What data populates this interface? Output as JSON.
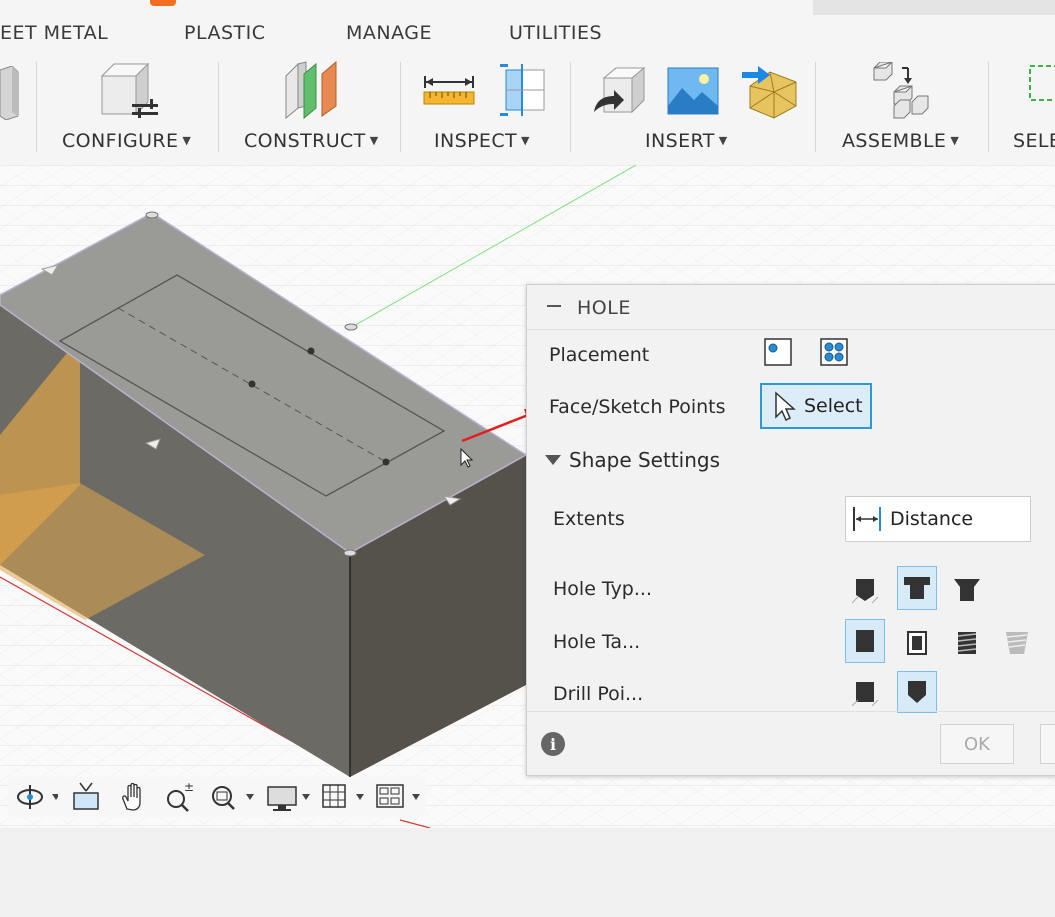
{
  "tabs": [
    "EET METAL",
    "PLASTIC",
    "MANAGE",
    "UTILITIES"
  ],
  "toolbar": {
    "configure": "CONFIGURE",
    "construct": "CONSTRUCT",
    "inspect": "INSPECT",
    "insert": "INSERT",
    "assemble": "ASSEMBLE",
    "select": "SELE"
  },
  "icons": {
    "configure": "configure-icon",
    "construct": "offset-plane-icon",
    "measure": "measure-icon",
    "section": "section-analysis-icon",
    "insert_derive": "insert-derive-icon",
    "canvas": "canvas-image-icon",
    "mesh": "insert-mesh-icon",
    "assemble": "new-component-icon"
  },
  "dialog": {
    "title": "HOLE",
    "placement_label": "Placement",
    "face_label": "Face/Sketch Points",
    "select_label": "Select",
    "shape_settings": "Shape Settings",
    "extents_label": "Extents",
    "extents_value": "Distance",
    "hole_type_label": "Hole Typ...",
    "hole_tap_label": "Hole Ta...",
    "drill_point_label": "Drill Poi...",
    "ok_label": "OK"
  },
  "colors": {
    "accent": "#2a9ad8",
    "body_top": "#9a9b97",
    "body_front": "#6a6964",
    "body_side": "#54514b",
    "sketch_plane": "#e0a54a"
  }
}
